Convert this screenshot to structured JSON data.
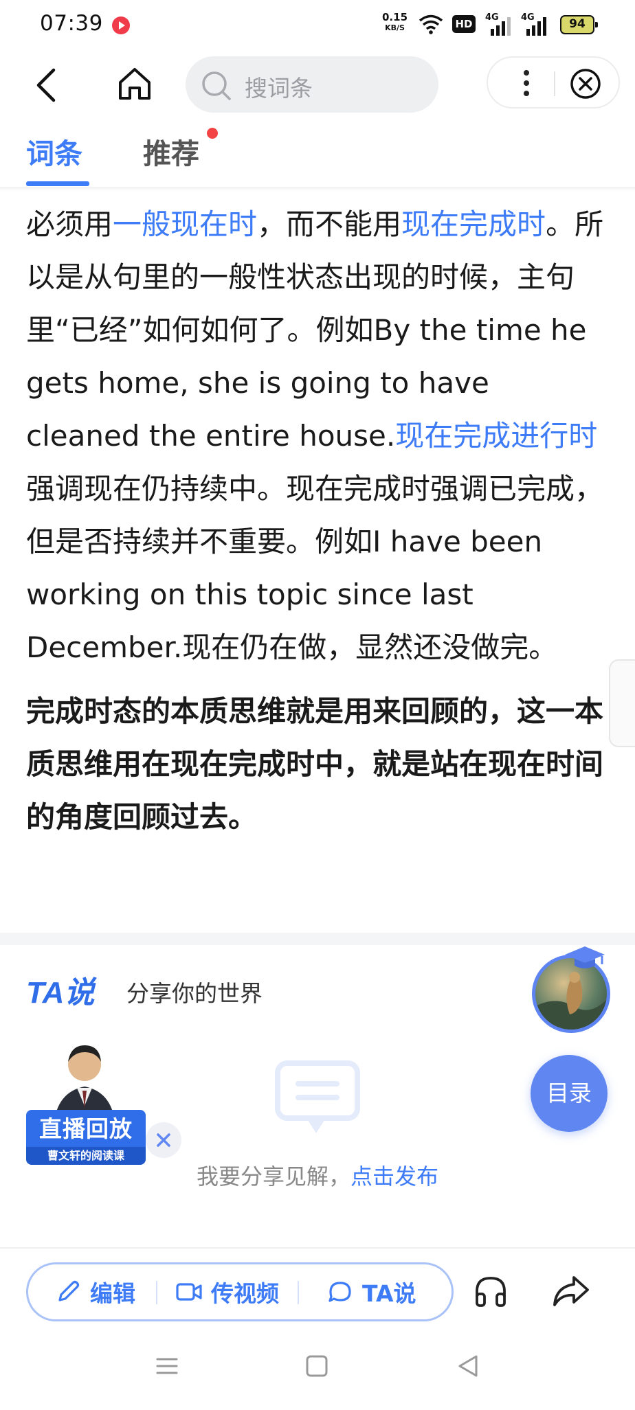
{
  "status_bar": {
    "time": "07:39",
    "net_speed_value": "0.15",
    "net_speed_unit": "KB/S",
    "hd_label": "HD",
    "signal1_label": "4G",
    "signal2_label": "4G",
    "battery": "94"
  },
  "nav": {
    "search_placeholder": "搜词条"
  },
  "tabs": [
    {
      "label": "词条",
      "active": true
    },
    {
      "label": "推荐",
      "active": false,
      "has_dot": true
    }
  ],
  "article": {
    "p1": [
      {
        "t": "必须用",
        "link": false
      },
      {
        "t": "一般现在时",
        "link": true
      },
      {
        "t": "，而不能用",
        "link": false
      },
      {
        "t": "现在完成时",
        "link": true
      },
      {
        "t": "。所以是从句里的一般性状态出现的时候，主句里“已经”如何如何了。例如By the time he gets home, she is going to have cleaned the entire house.",
        "link": false
      },
      {
        "t": "现在完成进行时",
        "link": true
      },
      {
        "t": "强调现在仍持续中。现在完成时强调已完成，但是否持续并不重要。例如I have been working on this topic since last December.现在仍在做，显然还没做完。",
        "link": false
      }
    ],
    "p2": "完成时态的本质思维就是用来回顾的，这一本质思维用在现在完成时中，就是站在现在时间的角度回顾过去。"
  },
  "ta_section": {
    "logo_text": "TA说",
    "slogan": "分享你的世界",
    "live_label": "直播回放",
    "live_sub": "曹文轩的阅读课",
    "share_prompt_text": "我要分享见解，",
    "share_prompt_link": "点击发布",
    "toc_label": "目录"
  },
  "action_bar": {
    "edit_label": "编辑",
    "video_label": "传视频",
    "ta_label": "TA说"
  },
  "colors": {
    "accent": "#3d7bf7",
    "toc_bg": "#5f86f1",
    "red_dot": "#f24444"
  }
}
